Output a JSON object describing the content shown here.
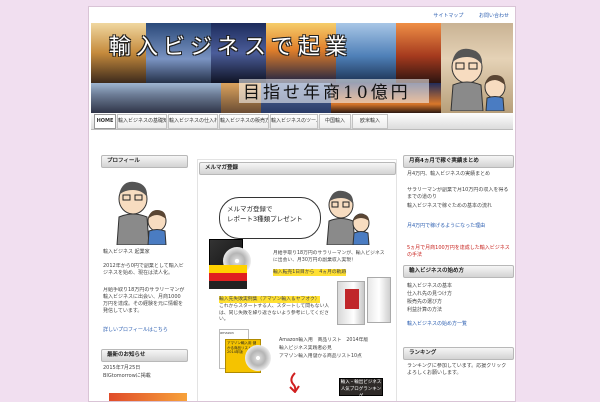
{
  "toplinks": [
    "サイトマップ",
    "お問い合わせ"
  ],
  "banner": {
    "title": "輸入ビジネスで起業",
    "subtitle": "目指せ年商10億円"
  },
  "nav": {
    "items": [
      {
        "label": "HOME"
      },
      {
        "label": "輸入ビジネスの基礎知識"
      },
      {
        "label": "輸入ビジネスの仕入れ先"
      },
      {
        "label": "輸入ビジネスの販売方法"
      },
      {
        "label": "輸入ビジネスのツール"
      },
      {
        "label": "中国輸入"
      },
      {
        "label": "欧米輸入"
      }
    ]
  },
  "left": {
    "profile_title": "プロフィール",
    "profile_name": "輸入ビジネス 起業家",
    "profile_text1": "2012年から0円で副業として輸入ビジネスを始め、現在は法人化。",
    "profile_text2": "月給手取り18万円のサラリーマンが輸入ビジネスに出会い、月商1000万円を達成。その経験を元に情報を発信しています。",
    "profile_link": "詳しいプロフィールはこちら",
    "news_title": "最新のお知らせ",
    "news_text": "2015年7月25日",
    "news_text2": "BIGtomorrowに掲載"
  },
  "main": {
    "box_title": "メルマガ登録",
    "speech": [
      "メルマガ登録で",
      "レポート3種類プレゼント"
    ],
    "offer1_text": "月給手取り18万円のサラリーマンが、輸入ビジネスに出会い、月30万円の副業収入実現！",
    "offer1_highlight": "輸入転売1日目から　4ヵ月の軌跡",
    "offer2_title": "輸入先失敗実例集（アマゾン輸入＆ヤフオク）",
    "offer2_text": "これからスタートする人、スタートして間もない人は、同じ失敗を繰り返さないよう参考にしてください。",
    "offer3_text1": "Amazon輸入用　商品リスト　2014年版",
    "offer3_text2": "輸入ビジネス実践者必見",
    "offer3_text3": "アマゾン輸入用儲かる商品リスト10点",
    "package_label": "アマゾン輸入用 儲かる商品リスト 2014年版",
    "amazon_label": "amazon"
  },
  "right": {
    "box1_title": "月商4ヵ月で稼ぐ実績まとめ",
    "box1_text1": "月4万円、輸入ビジネスの実績まとめ",
    "box1_text2": "サラリーマンが副業で月10万円の収入を得るまでの道のり",
    "box1_text3": "輸入ビジネスで稼ぐための基本の流れ",
    "box1_link": "月4万円で稼げるようになった理由",
    "box1_red": "5ヵ月で月商100万円を達成した輸入ビジネスの手法",
    "box2_title": "輸入ビジネスの始め方",
    "box2_items": [
      "輸入ビジネスの基本",
      "仕入れ先の見つけ方",
      "販売先の選び方",
      "利益計算の方法"
    ],
    "box2_link": "輸入ビジネスの始め方一覧",
    "box3_title": "ランキング",
    "box3_text": "ランキングに参加しています。応援クリックよろしくお願いします。",
    "badge_text": [
      "輸入・輸出ビジネス",
      "人気ブログランキング"
    ]
  },
  "colors": {
    "background": "#f1dff0",
    "link": "#2a5db0",
    "highlight": "#ffe033",
    "red": "#c8231e"
  }
}
